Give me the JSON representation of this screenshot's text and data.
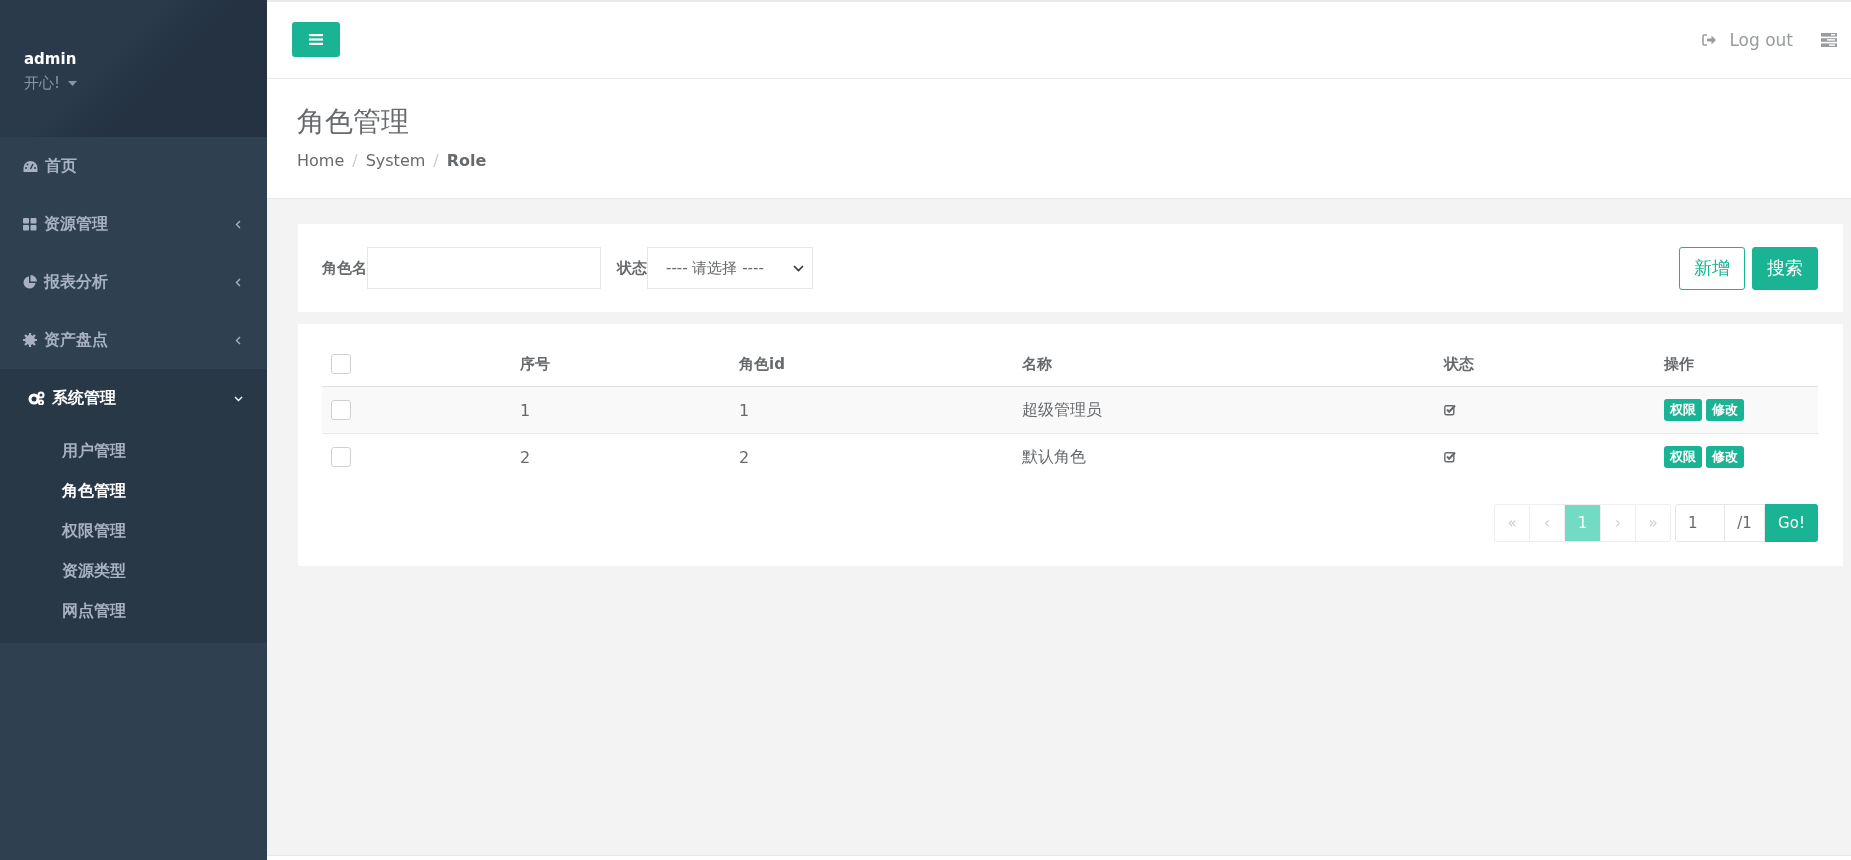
{
  "sidebar": {
    "user": {
      "name": "admin",
      "status": "开心!"
    },
    "items": [
      {
        "label": "首页",
        "kind": "link"
      },
      {
        "label": "资源管理",
        "kind": "group",
        "expanded": false
      },
      {
        "label": "报表分析",
        "kind": "group",
        "expanded": false
      },
      {
        "label": "资产盘点",
        "kind": "group",
        "expanded": false
      },
      {
        "label": "系统管理",
        "kind": "group",
        "expanded": true,
        "children": [
          {
            "label": "用户管理",
            "selected": false
          },
          {
            "label": "角色管理",
            "selected": true
          },
          {
            "label": "权限管理",
            "selected": false
          },
          {
            "label": "资源类型",
            "selected": false
          },
          {
            "label": "网点管理",
            "selected": false
          }
        ]
      }
    ]
  },
  "header": {
    "logout": "Log out"
  },
  "page": {
    "title": "角色管理",
    "breadcrumb": [
      {
        "label": "Home",
        "selected": false
      },
      {
        "separator": "/",
        "label": "System",
        "selected": false
      },
      {
        "separator": "/",
        "label": "Role",
        "selected": true
      }
    ]
  },
  "filter": {
    "name_label": "角色名",
    "status_label": "状态",
    "status_value": "---- 请选择 ----",
    "buttons": [
      {
        "label": "新增",
        "kind": "outline"
      },
      {
        "label": "搜索",
        "kind": "primary"
      }
    ]
  },
  "table": {
    "header_checked": false,
    "columns": [
      "序号",
      "角色id",
      "名称",
      "状态",
      "操作"
    ],
    "rows": [
      {
        "checked": false,
        "index": "1",
        "id": "1",
        "name": "超级管理员",
        "enabled": true,
        "actions": [
          "权限",
          "修改"
        ]
      },
      {
        "checked": false,
        "index": "2",
        "id": "2",
        "name": "默认角色",
        "enabled": true,
        "actions": [
          "权限",
          "修改"
        ]
      }
    ]
  },
  "pagination": {
    "first": {
      "label": "«",
      "disabled": true
    },
    "prev": {
      "label": "‹",
      "disabled": true
    },
    "pages": [
      {
        "label": "1",
        "selected": true
      }
    ],
    "next": {
      "label": "›",
      "disabled": true
    },
    "last": {
      "label": "»",
      "disabled": true
    },
    "page_value": "1",
    "total": "/1",
    "go": "Go!"
  }
}
